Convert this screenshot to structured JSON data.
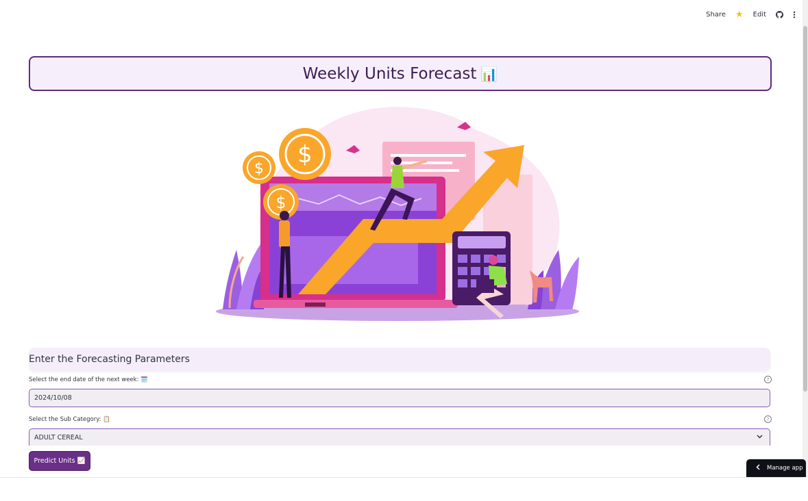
{
  "toolbar": {
    "share": "Share",
    "edit": "Edit"
  },
  "title": {
    "text": "Weekly Units Forecast",
    "emoji": "📊"
  },
  "params": {
    "header": "Enter the Forecasting Parameters",
    "date_label": "Select the end date of the next week: 🗓️",
    "date_value": "2024/10/08",
    "subcat_label": "Select the Sub Category: 📋",
    "subcat_value": "ADULT CEREAL"
  },
  "predict_button": "Predict Units 📈",
  "manage_app": "Manage app",
  "help_glyph": "?",
  "colors": {
    "brand": "#6a2f86",
    "title_border": "#5e2a7e",
    "accent_orange": "#f7941d",
    "accent_purple": "#8b59b0"
  }
}
